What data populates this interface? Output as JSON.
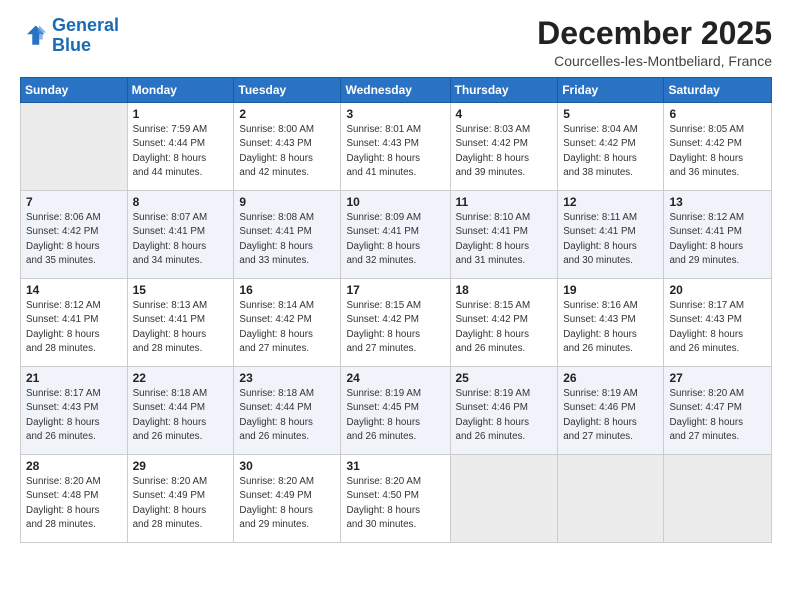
{
  "header": {
    "logo_line1": "General",
    "logo_line2": "Blue",
    "month": "December 2025",
    "location": "Courcelles-les-Montbeliard, France"
  },
  "days_of_week": [
    "Sunday",
    "Monday",
    "Tuesday",
    "Wednesday",
    "Thursday",
    "Friday",
    "Saturday"
  ],
  "weeks": [
    [
      {
        "num": "",
        "info": ""
      },
      {
        "num": "1",
        "info": "Sunrise: 7:59 AM\nSunset: 4:44 PM\nDaylight: 8 hours\nand 44 minutes."
      },
      {
        "num": "2",
        "info": "Sunrise: 8:00 AM\nSunset: 4:43 PM\nDaylight: 8 hours\nand 42 minutes."
      },
      {
        "num": "3",
        "info": "Sunrise: 8:01 AM\nSunset: 4:43 PM\nDaylight: 8 hours\nand 41 minutes."
      },
      {
        "num": "4",
        "info": "Sunrise: 8:03 AM\nSunset: 4:42 PM\nDaylight: 8 hours\nand 39 minutes."
      },
      {
        "num": "5",
        "info": "Sunrise: 8:04 AM\nSunset: 4:42 PM\nDaylight: 8 hours\nand 38 minutes."
      },
      {
        "num": "6",
        "info": "Sunrise: 8:05 AM\nSunset: 4:42 PM\nDaylight: 8 hours\nand 36 minutes."
      }
    ],
    [
      {
        "num": "7",
        "info": "Sunrise: 8:06 AM\nSunset: 4:42 PM\nDaylight: 8 hours\nand 35 minutes."
      },
      {
        "num": "8",
        "info": "Sunrise: 8:07 AM\nSunset: 4:41 PM\nDaylight: 8 hours\nand 34 minutes."
      },
      {
        "num": "9",
        "info": "Sunrise: 8:08 AM\nSunset: 4:41 PM\nDaylight: 8 hours\nand 33 minutes."
      },
      {
        "num": "10",
        "info": "Sunrise: 8:09 AM\nSunset: 4:41 PM\nDaylight: 8 hours\nand 32 minutes."
      },
      {
        "num": "11",
        "info": "Sunrise: 8:10 AM\nSunset: 4:41 PM\nDaylight: 8 hours\nand 31 minutes."
      },
      {
        "num": "12",
        "info": "Sunrise: 8:11 AM\nSunset: 4:41 PM\nDaylight: 8 hours\nand 30 minutes."
      },
      {
        "num": "13",
        "info": "Sunrise: 8:12 AM\nSunset: 4:41 PM\nDaylight: 8 hours\nand 29 minutes."
      }
    ],
    [
      {
        "num": "14",
        "info": "Sunrise: 8:12 AM\nSunset: 4:41 PM\nDaylight: 8 hours\nand 28 minutes."
      },
      {
        "num": "15",
        "info": "Sunrise: 8:13 AM\nSunset: 4:41 PM\nDaylight: 8 hours\nand 28 minutes."
      },
      {
        "num": "16",
        "info": "Sunrise: 8:14 AM\nSunset: 4:42 PM\nDaylight: 8 hours\nand 27 minutes."
      },
      {
        "num": "17",
        "info": "Sunrise: 8:15 AM\nSunset: 4:42 PM\nDaylight: 8 hours\nand 27 minutes."
      },
      {
        "num": "18",
        "info": "Sunrise: 8:15 AM\nSunset: 4:42 PM\nDaylight: 8 hours\nand 26 minutes."
      },
      {
        "num": "19",
        "info": "Sunrise: 8:16 AM\nSunset: 4:43 PM\nDaylight: 8 hours\nand 26 minutes."
      },
      {
        "num": "20",
        "info": "Sunrise: 8:17 AM\nSunset: 4:43 PM\nDaylight: 8 hours\nand 26 minutes."
      }
    ],
    [
      {
        "num": "21",
        "info": "Sunrise: 8:17 AM\nSunset: 4:43 PM\nDaylight: 8 hours\nand 26 minutes."
      },
      {
        "num": "22",
        "info": "Sunrise: 8:18 AM\nSunset: 4:44 PM\nDaylight: 8 hours\nand 26 minutes."
      },
      {
        "num": "23",
        "info": "Sunrise: 8:18 AM\nSunset: 4:44 PM\nDaylight: 8 hours\nand 26 minutes."
      },
      {
        "num": "24",
        "info": "Sunrise: 8:19 AM\nSunset: 4:45 PM\nDaylight: 8 hours\nand 26 minutes."
      },
      {
        "num": "25",
        "info": "Sunrise: 8:19 AM\nSunset: 4:46 PM\nDaylight: 8 hours\nand 26 minutes."
      },
      {
        "num": "26",
        "info": "Sunrise: 8:19 AM\nSunset: 4:46 PM\nDaylight: 8 hours\nand 27 minutes."
      },
      {
        "num": "27",
        "info": "Sunrise: 8:20 AM\nSunset: 4:47 PM\nDaylight: 8 hours\nand 27 minutes."
      }
    ],
    [
      {
        "num": "28",
        "info": "Sunrise: 8:20 AM\nSunset: 4:48 PM\nDaylight: 8 hours\nand 28 minutes."
      },
      {
        "num": "29",
        "info": "Sunrise: 8:20 AM\nSunset: 4:49 PM\nDaylight: 8 hours\nand 28 minutes."
      },
      {
        "num": "30",
        "info": "Sunrise: 8:20 AM\nSunset: 4:49 PM\nDaylight: 8 hours\nand 29 minutes."
      },
      {
        "num": "31",
        "info": "Sunrise: 8:20 AM\nSunset: 4:50 PM\nDaylight: 8 hours\nand 30 minutes."
      },
      {
        "num": "",
        "info": ""
      },
      {
        "num": "",
        "info": ""
      },
      {
        "num": "",
        "info": ""
      }
    ]
  ]
}
